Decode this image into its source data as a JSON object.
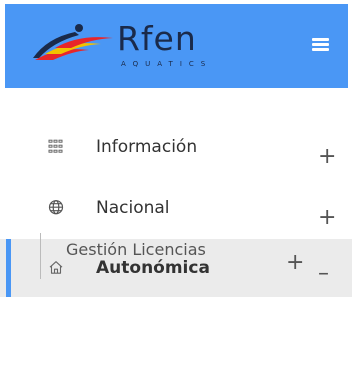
{
  "brand": {
    "name": "Rfen",
    "subtitle": "AQUATICS",
    "colors": {
      "header": "#4a97f5",
      "accent": "#4a97f5"
    }
  },
  "header": {
    "menu_icon": "hamburger-icon"
  },
  "nav": {
    "items": [
      {
        "label": "Información",
        "icon": "grid-icon",
        "toggle": "+"
      },
      {
        "label": "Nacional",
        "icon": "globe-icon",
        "toggle": "+"
      },
      {
        "label": "Autonómica",
        "icon": "home-icon",
        "toggle": "–",
        "active": true
      }
    ],
    "sub_items": [
      {
        "label": "Gestión Licencias",
        "toggle": "+"
      }
    ]
  }
}
